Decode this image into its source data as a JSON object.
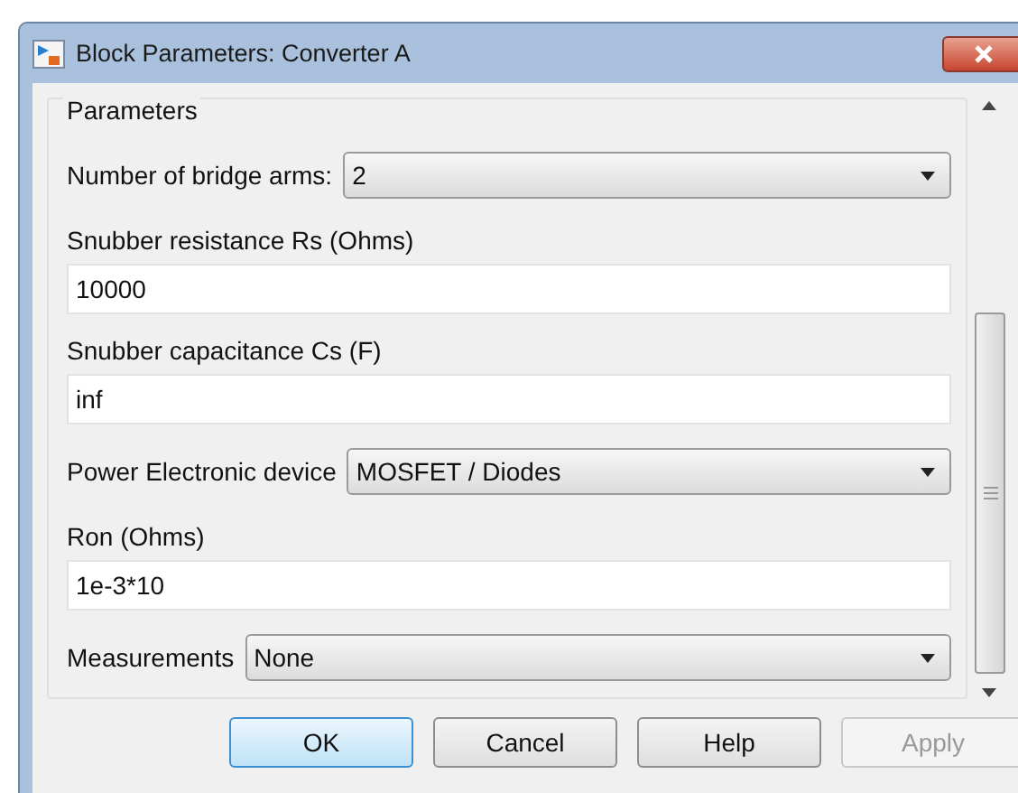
{
  "window": {
    "title": "Block Parameters: Converter A"
  },
  "group": {
    "title": "Parameters"
  },
  "fields": [
    {
      "kind": "dropdown",
      "label": "Number of bridge arms:",
      "value": "2"
    },
    {
      "kind": "text",
      "label": "Snubber resistance Rs (Ohms)",
      "value": "10000"
    },
    {
      "kind": "text",
      "label": "Snubber capacitance Cs (F)",
      "value": "inf"
    },
    {
      "kind": "dropdown",
      "label": "Power Electronic device",
      "value": "MOSFET / Diodes"
    },
    {
      "kind": "text",
      "label": "Ron (Ohms)",
      "value": "1e-3*10"
    },
    {
      "kind": "dropdown",
      "label": "Measurements",
      "value": "None"
    }
  ],
  "buttons": [
    {
      "label": "OK",
      "default": true,
      "disabled": false
    },
    {
      "label": "Cancel",
      "default": false,
      "disabled": false
    },
    {
      "label": "Help",
      "default": false,
      "disabled": false
    },
    {
      "label": "Apply",
      "default": false,
      "disabled": true
    }
  ]
}
